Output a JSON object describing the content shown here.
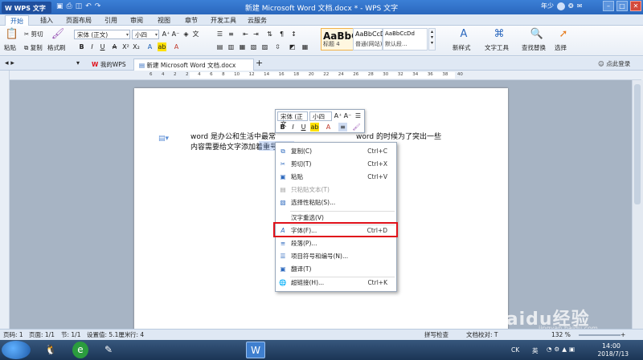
{
  "titlebar": {
    "app_name": "WPS 文字",
    "title": "新建 Microsoft Word 文档.docx * - WPS 文字",
    "user": "年少"
  },
  "menu_tabs": [
    "开始",
    "插入",
    "页面布局",
    "引用",
    "审阅",
    "视图",
    "章节",
    "开发工具",
    "云服务"
  ],
  "ribbon": {
    "paste": "粘贴",
    "cut": "剪切",
    "copy": "复制",
    "format_painter": "格式刷",
    "font_name": "宋体 (正文)",
    "font_size": "小四",
    "styles": [
      {
        "preview": "AaBbC",
        "name": "标题 4"
      },
      {
        "preview": "AaBbCcD",
        "name": "普通(网站)"
      },
      {
        "preview": "AaBbCcDd",
        "name": "默认段..."
      }
    ],
    "new_style": "新样式",
    "text_tools": "文字工具",
    "find_replace": "查找替换",
    "select": "选择"
  },
  "doc_tabs": [
    {
      "label": "我的WPS"
    },
    {
      "label": "新建 Microsoft Word 文档.docx *"
    }
  ],
  "tab_add": "+",
  "tab_login": "点此登录",
  "ruler_ticks": [
    "6",
    "4",
    "2",
    "2",
    "4",
    "6",
    "8",
    "10",
    "12",
    "14",
    "16",
    "18",
    "20",
    "22",
    "24",
    "26",
    "28",
    "30",
    "32",
    "34",
    "36",
    "38",
    "40"
  ],
  "document": {
    "line1_a": "word 是办公和生活中最常",
    "line1_b": "word 的时候为了突出一些",
    "line2": "内容需要给文字添加着重号，word 如何给文字添加着重号呢？"
  },
  "minibar": {
    "font_name": "宋体 (正文",
    "font_size": "小四"
  },
  "context_menu": [
    {
      "label": "复制(C)",
      "shortcut": "Ctrl+C",
      "icon": "copy-icon",
      "enabled": true
    },
    {
      "label": "剪切(T)",
      "shortcut": "Ctrl+X",
      "icon": "scissors-icon",
      "enabled": true
    },
    {
      "label": "粘贴",
      "shortcut": "Ctrl+V",
      "icon": "paste-icon",
      "enabled": true
    },
    {
      "label": "只粘贴文本(T)",
      "shortcut": "",
      "icon": "paste-text-icon",
      "enabled": false
    },
    {
      "label": "选择性粘贴(S)...",
      "shortcut": "",
      "icon": "paste-special-icon",
      "enabled": true
    },
    {
      "label": "汉字重选(V)",
      "shortcut": "",
      "icon": "",
      "enabled": true
    },
    {
      "label": "字体(F)...",
      "shortcut": "Ctrl+D",
      "icon": "font-icon",
      "enabled": true
    },
    {
      "label": "段落(P)...",
      "shortcut": "",
      "icon": "paragraph-icon",
      "enabled": true
    },
    {
      "label": "项目符号和编号(N)...",
      "shortcut": "",
      "icon": "bullets-icon",
      "enabled": true
    },
    {
      "label": "翻译(T)",
      "shortcut": "",
      "icon": "translate-icon",
      "enabled": true
    },
    {
      "label": "超链接(H)...",
      "shortcut": "Ctrl+K",
      "icon": "hyperlink-icon",
      "enabled": true
    }
  ],
  "statusbar": {
    "word_count": "页码: 1",
    "pages": "页面: 1/1",
    "section": "节: 1/1",
    "setting": "设置值: 5.1厘米",
    "row": "行: 4",
    "zoom": "132 %",
    "spell_check": "拼写检查",
    "doc_proof": "文档校对: T"
  },
  "taskbar": {
    "time": "14:00",
    "date": "2018/7/13",
    "ime": "CK",
    "ime2": "英"
  },
  "watermark": "Baidu经验",
  "watermark_sub": "jingyan.baidu.com",
  "colors": {
    "accent": "#2a67bd",
    "highlight": "#e0101a"
  }
}
